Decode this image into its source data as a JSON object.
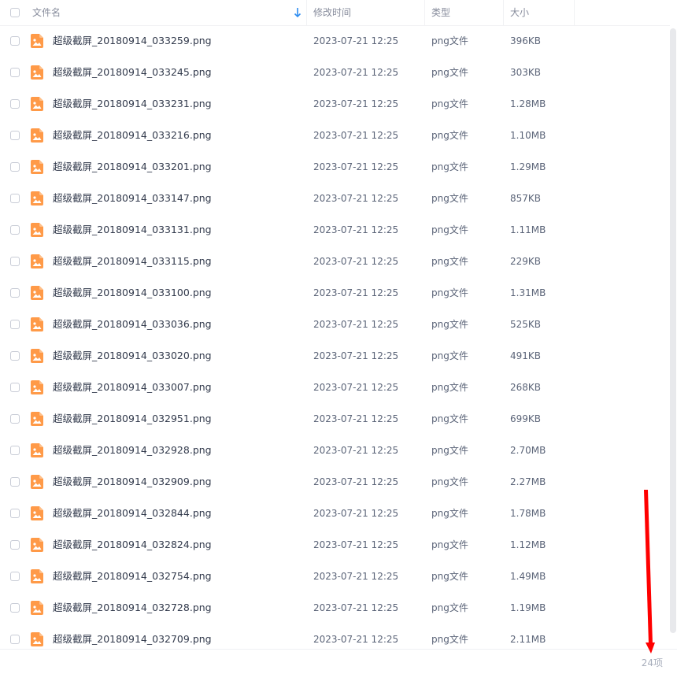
{
  "header": {
    "name_label": "文件名",
    "date_label": "修改时间",
    "type_label": "类型",
    "size_label": "大小"
  },
  "colors": {
    "file_icon": "#ff9a48",
    "sort_arrow": "#2d8cf0",
    "annotation_arrow": "#ff0000"
  },
  "files": [
    {
      "name": "超级截屏_20180914_033259.png",
      "date": "2023-07-21 12:25",
      "type": "png文件",
      "size": "396KB"
    },
    {
      "name": "超级截屏_20180914_033245.png",
      "date": "2023-07-21 12:25",
      "type": "png文件",
      "size": "303KB"
    },
    {
      "name": "超级截屏_20180914_033231.png",
      "date": "2023-07-21 12:25",
      "type": "png文件",
      "size": "1.28MB"
    },
    {
      "name": "超级截屏_20180914_033216.png",
      "date": "2023-07-21 12:25",
      "type": "png文件",
      "size": "1.10MB"
    },
    {
      "name": "超级截屏_20180914_033201.png",
      "date": "2023-07-21 12:25",
      "type": "png文件",
      "size": "1.29MB"
    },
    {
      "name": "超级截屏_20180914_033147.png",
      "date": "2023-07-21 12:25",
      "type": "png文件",
      "size": "857KB"
    },
    {
      "name": "超级截屏_20180914_033131.png",
      "date": "2023-07-21 12:25",
      "type": "png文件",
      "size": "1.11MB"
    },
    {
      "name": "超级截屏_20180914_033115.png",
      "date": "2023-07-21 12:25",
      "type": "png文件",
      "size": "229KB"
    },
    {
      "name": "超级截屏_20180914_033100.png",
      "date": "2023-07-21 12:25",
      "type": "png文件",
      "size": "1.31MB"
    },
    {
      "name": "超级截屏_20180914_033036.png",
      "date": "2023-07-21 12:25",
      "type": "png文件",
      "size": "525KB"
    },
    {
      "name": "超级截屏_20180914_033020.png",
      "date": "2023-07-21 12:25",
      "type": "png文件",
      "size": "491KB"
    },
    {
      "name": "超级截屏_20180914_033007.png",
      "date": "2023-07-21 12:25",
      "type": "png文件",
      "size": "268KB"
    },
    {
      "name": "超级截屏_20180914_032951.png",
      "date": "2023-07-21 12:25",
      "type": "png文件",
      "size": "699KB"
    },
    {
      "name": "超级截屏_20180914_032928.png",
      "date": "2023-07-21 12:25",
      "type": "png文件",
      "size": "2.70MB"
    },
    {
      "name": "超级截屏_20180914_032909.png",
      "date": "2023-07-21 12:25",
      "type": "png文件",
      "size": "2.27MB"
    },
    {
      "name": "超级截屏_20180914_032844.png",
      "date": "2023-07-21 12:25",
      "type": "png文件",
      "size": "1.78MB"
    },
    {
      "name": "超级截屏_20180914_032824.png",
      "date": "2023-07-21 12:25",
      "type": "png文件",
      "size": "1.12MB"
    },
    {
      "name": "超级截屏_20180914_032754.png",
      "date": "2023-07-21 12:25",
      "type": "png文件",
      "size": "1.49MB"
    },
    {
      "name": "超级截屏_20180914_032728.png",
      "date": "2023-07-21 12:25",
      "type": "png文件",
      "size": "1.19MB"
    },
    {
      "name": "超级截屏_20180914_032709.png",
      "date": "2023-07-21 12:25",
      "type": "png文件",
      "size": "2.11MB"
    }
  ],
  "footer": {
    "count_label": "24项"
  }
}
